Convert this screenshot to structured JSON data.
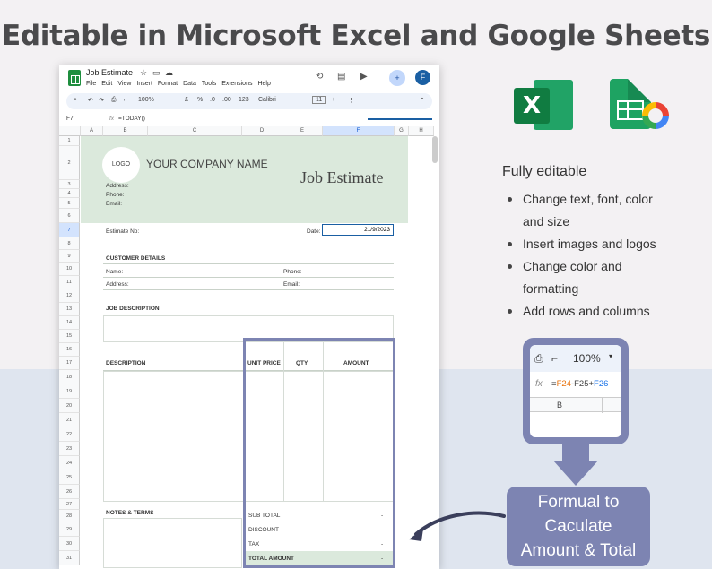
{
  "headline": "Editable in Microsoft Excel and Google Sheets",
  "sheet": {
    "doc_title": "Job Estimate",
    "menu": [
      "File",
      "Edit",
      "View",
      "Insert",
      "Format",
      "Data",
      "Tools",
      "Extensions",
      "Help"
    ],
    "avatar": "F",
    "toolbar": {
      "zoom": "100%",
      "currency": "£",
      "percent": "%",
      "dec1": ".0",
      "dec2": ".00",
      "numfmt": "123",
      "font": "Calibri",
      "font_size": "11"
    },
    "cell_ref": "F7",
    "formula": "=TODAY()",
    "columns": [
      "A",
      "B",
      "C",
      "D",
      "E",
      "F",
      "G",
      "H"
    ],
    "rows": [
      "1",
      "2",
      "3",
      "4",
      "5",
      "6",
      "7",
      "8",
      "9",
      "10",
      "11",
      "12",
      "13",
      "14",
      "15",
      "16",
      "17",
      "18",
      "19",
      "20",
      "21",
      "22",
      "23",
      "24",
      "25",
      "26",
      "27",
      "28",
      "29",
      "30",
      "31"
    ],
    "template": {
      "logo": "LOGO",
      "company": "YOUR COMPANY NAME",
      "address": "Address:",
      "phone": "Phone:",
      "email": "Email:",
      "doc_heading": "Job Estimate",
      "estimate_no": "Estimate No:",
      "date_label": "Date:",
      "date_value": "21/9/2023",
      "customer_details": "CUSTOMER DETAILS",
      "name": "Name:",
      "cust_phone": "Phone:",
      "cust_address": "Address:",
      "cust_email": "Email:",
      "job_description": "JOB DESCRIPTION",
      "description": "DESCRIPTION",
      "unit_price": "UNIT PRICE",
      "qty": "QTY",
      "amount": "AMOUNT",
      "notes_terms": "NOTES & TERMS",
      "sub_total": "SUB TOTAL",
      "discount": "DISCOUNT",
      "tax": "TAX",
      "total_amount": "TOTAL AMOUNT",
      "dash": "-"
    }
  },
  "features": {
    "title": "Fully editable",
    "items": [
      "Change text, font, color and size",
      "Insert images and logos",
      "Change color and formatting",
      "Add rows and columns"
    ]
  },
  "callout": {
    "zoom": "100%",
    "fx": "fx",
    "formula_parts": [
      "=",
      "F24",
      "-",
      "F25",
      "+",
      "F26"
    ],
    "col": "B",
    "label_lines": [
      "Formual to",
      "Caculate",
      "Amount & Total"
    ]
  },
  "logos": {
    "excel_letter": "X"
  }
}
